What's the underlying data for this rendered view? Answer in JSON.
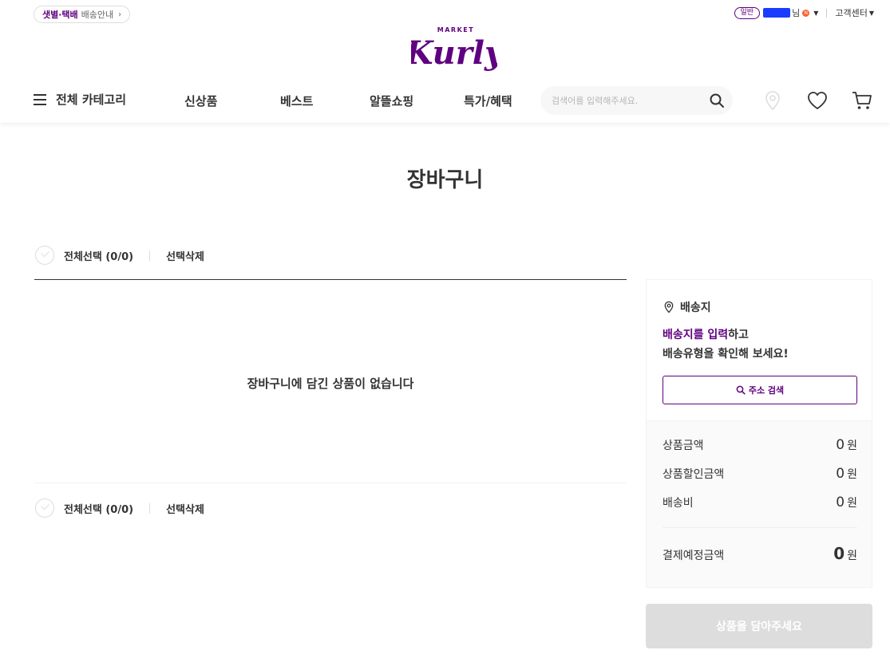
{
  "top": {
    "delivery_accent": "샛별·택배",
    "delivery_label": "배송안내",
    "delivery_chevron": "›",
    "grade": "일반",
    "name_suffix": "님",
    "customer_center": "고객센터"
  },
  "logo": {
    "small": "MARKET",
    "main": "Kurly"
  },
  "gnb": {
    "all_categories": "전체 카테고리",
    "items": [
      "신상품",
      "베스트",
      "알뜰쇼핑",
      "특가/혜택"
    ],
    "search_placeholder": "검색어를 입력해주세요."
  },
  "page": {
    "title": "장바구니",
    "select_all": "전체선택 (0/0)",
    "delete_selected": "선택삭제",
    "empty_message": "장바구니에 담긴 상품이 없습니다"
  },
  "address": {
    "label": "배송지",
    "prompt_accent": "배송지를 입력",
    "prompt_rest": "하고",
    "prompt_line2": "배송유형을 확인해 보세요!",
    "search_button": "주소 검색"
  },
  "summary": {
    "rows": [
      {
        "label": "상품금액",
        "value": "0",
        "unit": "원"
      },
      {
        "label": "상품할인금액",
        "value": "0",
        "unit": "원"
      },
      {
        "label": "배송비",
        "value": "0",
        "unit": "원"
      }
    ],
    "total_label": "결제예정금액",
    "total_value": "0",
    "total_unit": "원"
  },
  "order_button": "상품을 담아주세요",
  "colors": {
    "brand": "#5f0080",
    "disabled": "#dddddd"
  }
}
